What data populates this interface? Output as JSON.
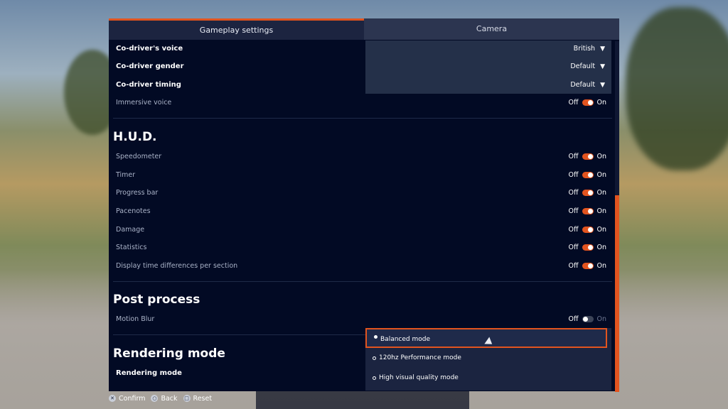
{
  "tabs": [
    {
      "label": "Gameplay settings",
      "active": true
    },
    {
      "label": "Camera",
      "active": false
    }
  ],
  "co_driver": {
    "voice": {
      "label": "Co-driver's voice",
      "value": "British"
    },
    "gender": {
      "label": "Co-driver gender",
      "value": "Default"
    },
    "timing": {
      "label": "Co-driver timing",
      "value": "Default"
    },
    "immersive": {
      "label": "Immersive voice",
      "off": "Off",
      "on": "On",
      "state": "on"
    }
  },
  "hud": {
    "title": "H.U.D.",
    "items": [
      {
        "label": "Speedometer",
        "off": "Off",
        "on": "On",
        "state": "on"
      },
      {
        "label": "Timer",
        "off": "Off",
        "on": "On",
        "state": "on"
      },
      {
        "label": "Progress bar",
        "off": "Off",
        "on": "On",
        "state": "on"
      },
      {
        "label": "Pacenotes",
        "off": "Off",
        "on": "On",
        "state": "on"
      },
      {
        "label": "Damage",
        "off": "Off",
        "on": "On",
        "state": "on"
      },
      {
        "label": "Statistics",
        "off": "Off",
        "on": "On",
        "state": "on"
      },
      {
        "label": "Display time differences per section",
        "off": "Off",
        "on": "On",
        "state": "on"
      }
    ]
  },
  "post_process": {
    "title": "Post process",
    "motion_blur": {
      "label": "Motion Blur",
      "off": "Off",
      "on": "On",
      "state": "off"
    }
  },
  "rendering": {
    "title": "Rendering mode",
    "label": "Rendering mode",
    "options": [
      {
        "label": "Balanced mode",
        "selected": true
      },
      {
        "label": "120hz Performance mode",
        "selected": false
      },
      {
        "label": "High visual quality mode",
        "selected": false
      }
    ]
  },
  "footer": {
    "confirm": "Confirm",
    "back": "Back",
    "reset": "Reset"
  },
  "icons": {
    "dropdown": "chevron-down-icon",
    "confirm": "cross-button-icon",
    "back": "circle-button-icon",
    "reset": "square-button-icon"
  },
  "colors": {
    "accent": "#e2541f",
    "panel": "#020a24",
    "dropdown": "#243049"
  }
}
